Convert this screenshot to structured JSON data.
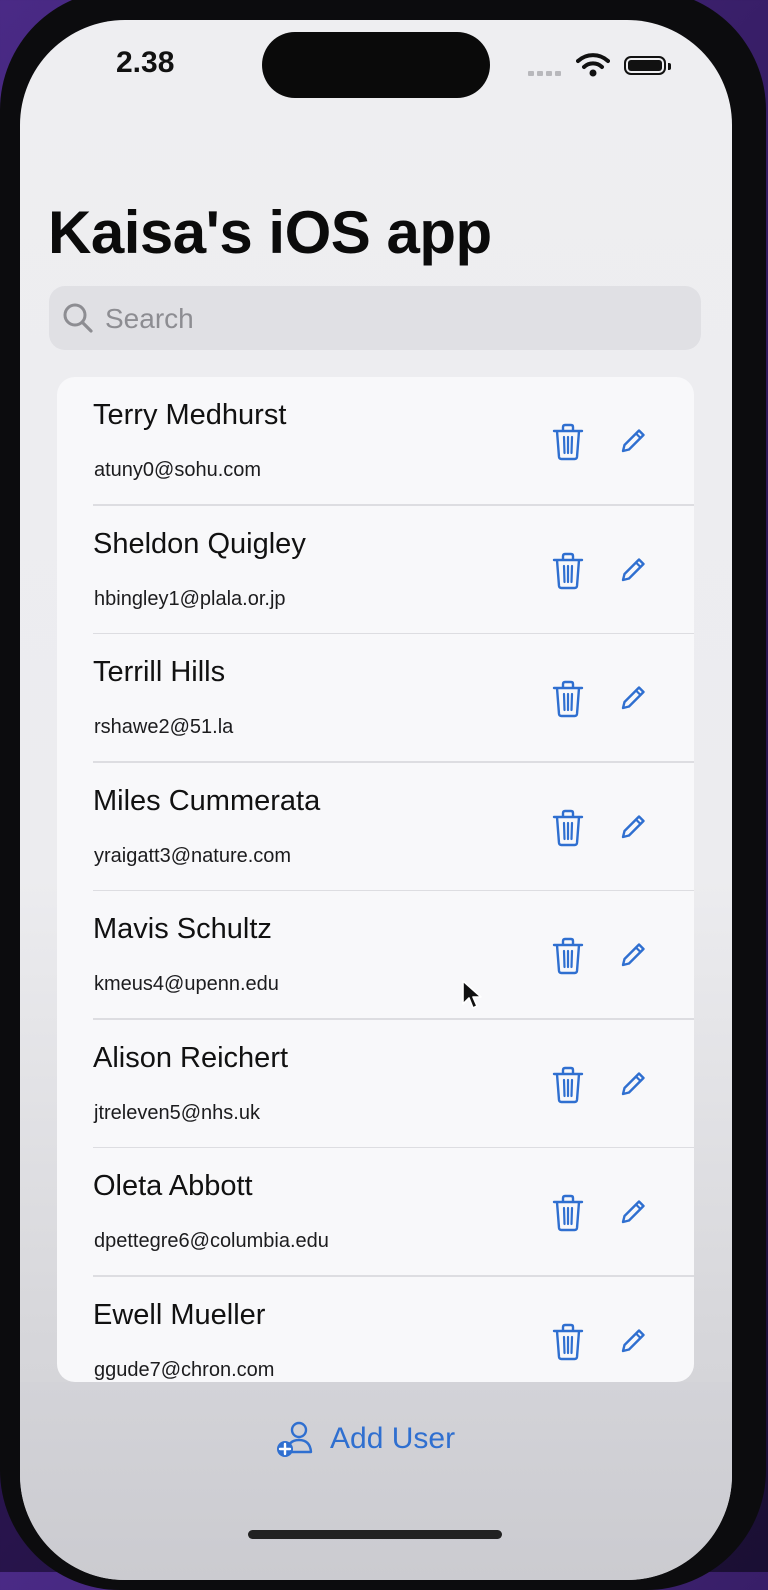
{
  "status_bar": {
    "time": "2.38"
  },
  "app": {
    "title": "Kaisa's iOS app"
  },
  "search": {
    "placeholder": "Search",
    "value": ""
  },
  "users": [
    {
      "name": "Terry Medhurst",
      "email": "atuny0@sohu.com"
    },
    {
      "name": "Sheldon Quigley",
      "email": "hbingley1@plala.or.jp"
    },
    {
      "name": "Terrill Hills",
      "email": "rshawe2@51.la"
    },
    {
      "name": "Miles Cummerata",
      "email": "yraigatt3@nature.com"
    },
    {
      "name": "Mavis Schultz",
      "email": "kmeus4@upenn.edu"
    },
    {
      "name": "Alison Reichert",
      "email": "jtreleven5@nhs.uk"
    },
    {
      "name": "Oleta Abbott",
      "email": "dpettegre6@columbia.edu"
    },
    {
      "name": "Ewell Mueller",
      "email": "ggude7@chron.com"
    }
  ],
  "footer": {
    "add_user_label": "Add User"
  },
  "icons": {
    "row_actions": [
      "trash-icon",
      "pencil-icon"
    ],
    "add_user": "person-badge-plus-icon",
    "search": "magnifying-glass-icon"
  },
  "colors": {
    "accent": "#2f6fd0",
    "text": "#111111",
    "placeholder": "#8d8d92"
  }
}
